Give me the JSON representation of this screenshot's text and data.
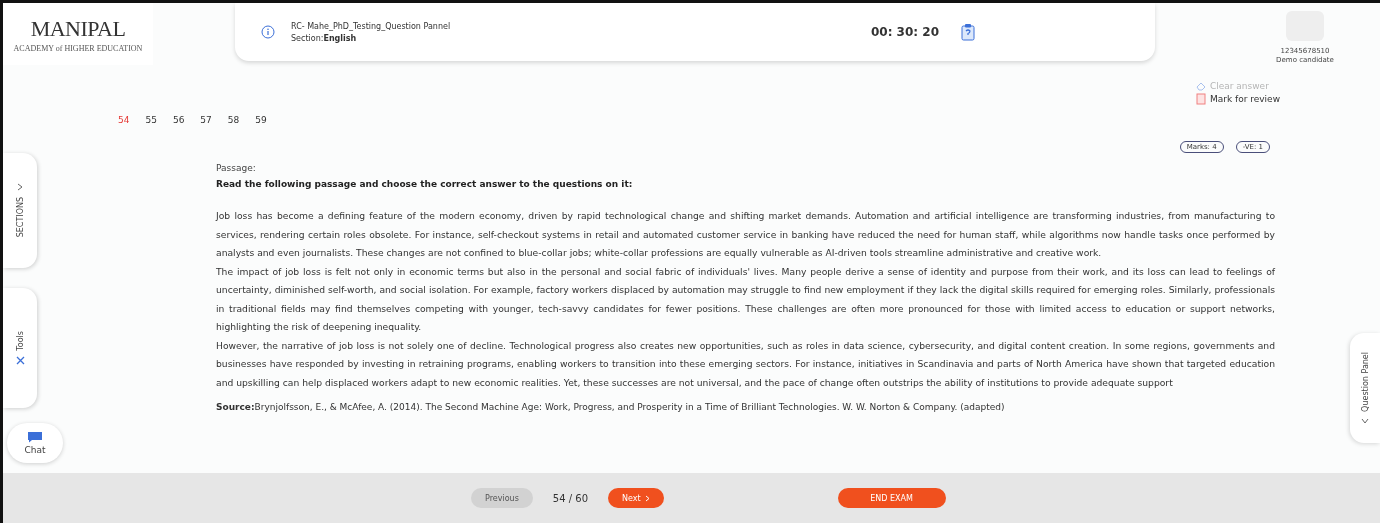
{
  "logo": {
    "name": "MANIPAL",
    "tagline": "ACADEMY of HIGHER EDUCATION"
  },
  "header": {
    "exam_title": "RC- Mahe_PhD_Testing_Question Pannel",
    "section_label": "Section:",
    "section_value": "English",
    "timer": "00: 30: 20"
  },
  "candidate": {
    "id": "12345678510",
    "name": "Demo candidate"
  },
  "actions": [
    {
      "label": "Clear answer",
      "disabled": true
    },
    {
      "label": "Mark for review",
      "disabled": false
    }
  ],
  "questions": [
    {
      "label": "54",
      "selected": true
    },
    {
      "label": "55",
      "selected": false
    },
    {
      "label": "56",
      "selected": false
    },
    {
      "label": "57",
      "selected": false
    },
    {
      "label": "58",
      "selected": false
    },
    {
      "label": "59",
      "selected": false
    }
  ],
  "badges": [
    "Marks: 4",
    "-VE: 1"
  ],
  "side_tabs": [
    {
      "label": "SECTIONS",
      "kind": "sections"
    },
    {
      "label": "Tools",
      "kind": "tools"
    }
  ],
  "question_panel_tab": "Question Panel",
  "chat": "Chat",
  "passage": {
    "label": "Passage:",
    "instruction": "Read the following passage and choose the correct answer to the questions on it:",
    "paragraphs": [
      "Job loss has become a defining feature of the modern economy, driven by rapid technological change and shifting market demands. Automation and artificial intelligence are transforming industries, from manufacturing to services, rendering certain roles obsolete. For instance, self-checkout systems in retail and automated customer service in banking have reduced the need for human staff, while algorithms now handle tasks once performed by analysts and even journalists. These changes are not confined to blue-collar jobs; white-collar professions are equally vulnerable as AI-driven tools streamline administrative and creative work.",
      "The impact of job loss is felt not only in economic terms but also in the personal and social fabric of individuals' lives. Many people derive a sense of identity and purpose from their work, and its loss can lead to feelings of uncertainty, diminished self-worth, and social isolation. For example, factory workers displaced by automation may struggle to find new employment if they lack the digital skills required for emerging roles. Similarly, professionals in traditional fields may find themselves competing with younger, tech-savvy candidates for fewer positions. These challenges are often more pronounced for those with limited access to education or support networks, highlighting the risk of deepening inequality.",
      "However, the narrative of job loss is not solely one of decline. Technological progress also creates new opportunities, such as roles in data science, cybersecurity, and digital content creation. In some regions, governments and businesses have responded by investing in retraining programs, enabling workers to transition into these emerging sectors. For instance, initiatives in Scandinavia and parts of North America have shown that targeted education and upskilling can help displaced workers adapt to new economic realities. Yet, these successes are not universal, and the pace of change often outstrips the ability of institutions to provide adequate support"
    ],
    "source": "**Source:**Brynjolfsson, E., & McAfee, A. (2014). The Second Machine Age: Work, Progress, and Prosperity in a Time of Brilliant Technologies. W. W. Norton & Company. (adapted)"
  },
  "footer": {
    "previous": {
      "label": "Previous",
      "disabled": true
    },
    "counter": "54 / 60",
    "next": {
      "label": "Next",
      "disabled": false
    },
    "end": "END EXAM"
  }
}
